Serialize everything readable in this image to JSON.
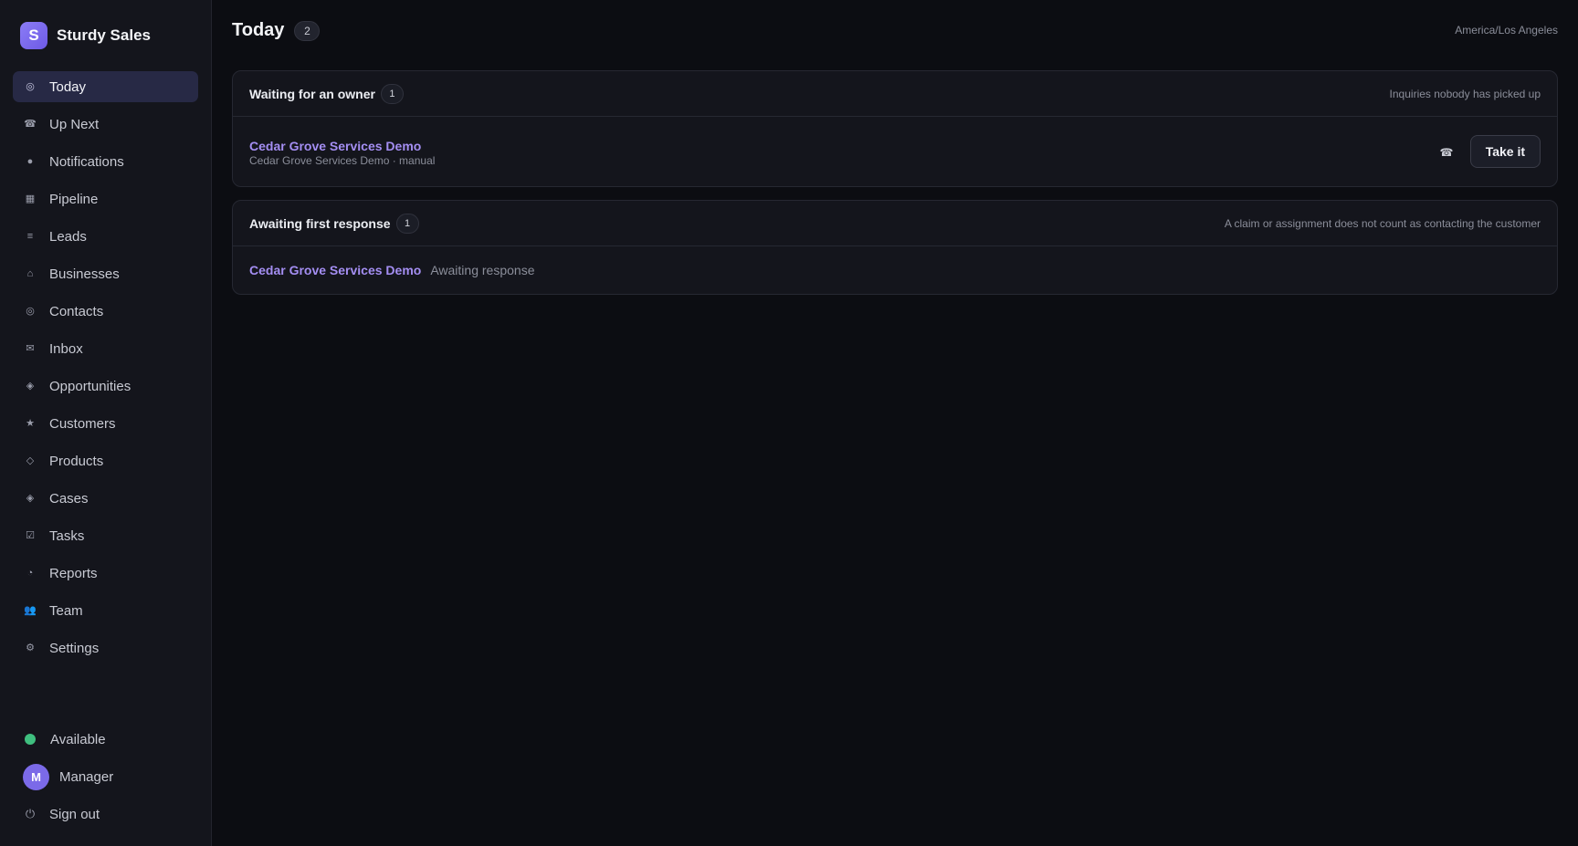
{
  "app": {
    "name": "Sturdy Sales",
    "logo_letter": "S",
    "accent_color": "#7b6ae8"
  },
  "sidebar": {
    "items": [
      {
        "label": "Today",
        "icon": "today-icon",
        "glyph": "◎",
        "active": true
      },
      {
        "label": "Up Next",
        "icon": "phone-icon",
        "glyph": "☎",
        "active": false
      },
      {
        "label": "Notifications",
        "icon": "bell-icon",
        "glyph": "●",
        "active": false
      },
      {
        "label": "Pipeline",
        "icon": "grid-icon",
        "glyph": "▦",
        "active": false
      },
      {
        "label": "Leads",
        "icon": "list-icon",
        "glyph": "≡",
        "active": false
      },
      {
        "label": "Businesses",
        "icon": "building-icon",
        "glyph": "⌂",
        "active": false
      },
      {
        "label": "Contacts",
        "icon": "contact-icon",
        "glyph": "◎",
        "active": false
      },
      {
        "label": "Inbox",
        "icon": "mail-icon",
        "glyph": "✉",
        "active": false
      },
      {
        "label": "Opportunities",
        "icon": "diamond-icon",
        "glyph": "◈",
        "active": false
      },
      {
        "label": "Customers",
        "icon": "star-icon",
        "glyph": "★",
        "active": false
      },
      {
        "label": "Products",
        "icon": "box-icon",
        "glyph": "◇",
        "active": false
      },
      {
        "label": "Cases",
        "icon": "case-icon",
        "glyph": "◈",
        "active": false
      },
      {
        "label": "Tasks",
        "icon": "check-square-icon",
        "glyph": "☑",
        "active": false
      },
      {
        "label": "Reports",
        "icon": "pie-chart-icon",
        "glyph": "◔",
        "active": false
      },
      {
        "label": "Team",
        "icon": "team-icon",
        "glyph": "👥",
        "active": false
      },
      {
        "label": "Settings",
        "icon": "gear-icon",
        "glyph": "⚙",
        "active": false
      }
    ],
    "status": {
      "label": "Available",
      "color": "#3fbf7f"
    },
    "user": {
      "initial": "M",
      "label": "Manager"
    },
    "signout": {
      "label": "Sign out",
      "glyph": "⏻"
    }
  },
  "page": {
    "title": "Today",
    "count": "2",
    "timezone": "America/Los Angeles"
  },
  "owner_card": {
    "title": "Waiting for an owner",
    "count": "1",
    "note": "Inquiries nobody has picked up",
    "item": {
      "name": "Cedar Grove Services Demo",
      "sub": "Cedar Grove Services Demo · manual",
      "phone_glyph": "☎",
      "action_label": "Take it"
    }
  },
  "response_card": {
    "title": "Awaiting first response",
    "count": "1",
    "note": "A claim or assignment does not count as contacting the customer",
    "item": {
      "name": "Cedar Grove Services Demo",
      "status": "Awaiting response"
    }
  }
}
